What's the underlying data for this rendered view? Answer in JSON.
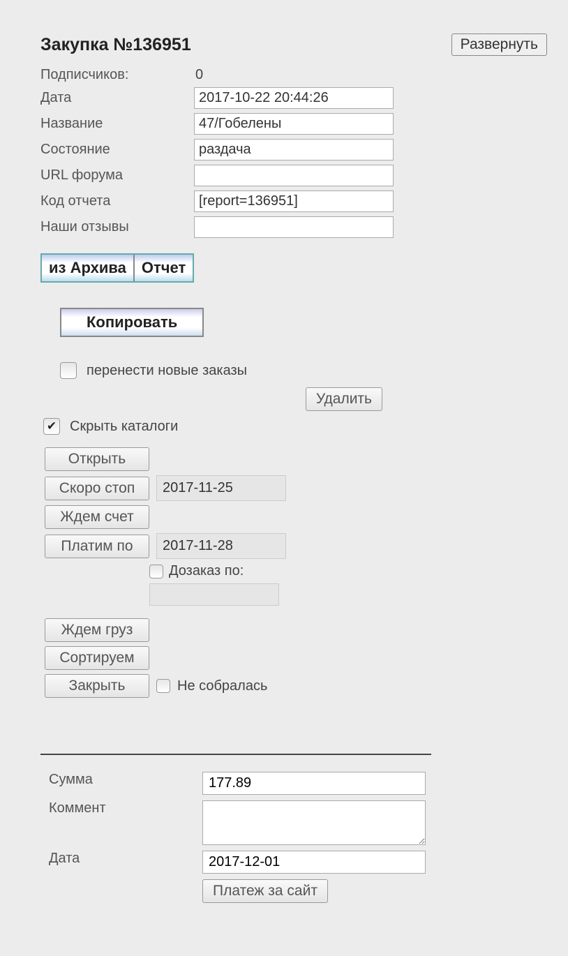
{
  "heading": "Закупка №136951",
  "expand_label": "Развернуть",
  "top_form": {
    "labels": {
      "subscribers": "Подписчиков:",
      "date": "Дата",
      "name": "Название",
      "state": "Состояние",
      "forum_url": "URL форума",
      "report_code": "Код отчета",
      "our_reviews": "Наши отзывы"
    },
    "values": {
      "subscribers": "0",
      "date": "2017-10-22 20:44:26",
      "name": "47/Гобелены",
      "state": "раздача",
      "forum_url": "",
      "report_code": "[report=136951]",
      "our_reviews": ""
    }
  },
  "toolbar": {
    "from_archive": "из Архива",
    "report": "Отчет"
  },
  "copy_label": "Копировать",
  "transfer": {
    "label": "перенести новые заказы",
    "checked": false
  },
  "delete_label": "Удалить",
  "hide_catalogs": {
    "label": "Скрыть каталоги",
    "checked": true
  },
  "status": {
    "open": "Открыть",
    "soon_stop": "Скоро стоп",
    "soon_stop_date": "2017-11-25",
    "wait_invoice": "Ждем счет",
    "pay_by": "Платим по",
    "pay_by_date": "2017-11-28",
    "dozakaz": {
      "label": "Дозаказ по:",
      "checked": false,
      "value": ""
    },
    "wait_cargo": "Ждем груз",
    "sorting": "Сортируем",
    "close": "Закрыть",
    "not_gathered": {
      "label": "Не собралась",
      "checked": false
    }
  },
  "payment": {
    "labels": {
      "sum": "Сумма",
      "comment": "Коммент",
      "date": "Дата"
    },
    "values": {
      "sum": "177.89",
      "comment": "",
      "date": "2017-12-01"
    },
    "button": "Платеж за сайт"
  }
}
